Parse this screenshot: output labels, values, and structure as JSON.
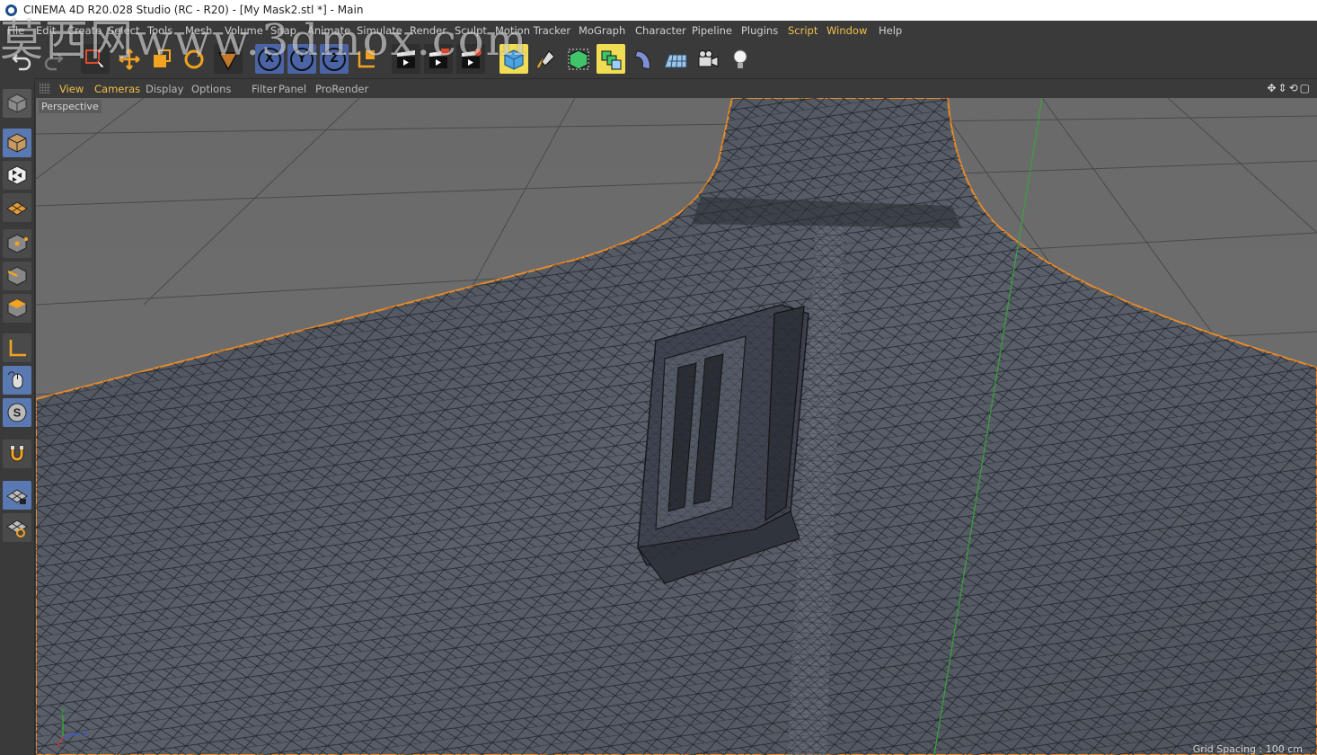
{
  "window": {
    "title": "CINEMA 4D R20.028 Studio (RC - R20) - [My Mask2.stl *] - Main"
  },
  "menu": {
    "items": [
      {
        "label": "File",
        "hl": false
      },
      {
        "label": "Edit",
        "hl": false
      },
      {
        "label": "Create",
        "hl": false
      },
      {
        "label": "Select",
        "hl": false
      },
      {
        "label": "Tools",
        "hl": false
      },
      {
        "label": "Mesh",
        "hl": false
      },
      {
        "label": "Volume",
        "hl": false
      },
      {
        "label": "Snap",
        "hl": false
      },
      {
        "label": "Animate",
        "hl": false
      },
      {
        "label": "Simulate",
        "hl": false
      },
      {
        "label": "Render",
        "hl": false
      },
      {
        "label": "Sculpt",
        "hl": false
      },
      {
        "label": "Motion Tracker",
        "hl": false
      },
      {
        "label": "MoGraph",
        "hl": false
      },
      {
        "label": "Character",
        "hl": false
      },
      {
        "label": "Pipeline",
        "hl": false
      },
      {
        "label": "Plugins",
        "hl": false
      },
      {
        "label": "Script",
        "hl": true
      },
      {
        "label": "Window",
        "hl": true
      },
      {
        "label": "Help",
        "hl": false
      }
    ]
  },
  "toolbar": {
    "axis_x": "X",
    "axis_y": "Y",
    "axis_z": "Z"
  },
  "viewport": {
    "menu": [
      {
        "label": "View",
        "hl": true
      },
      {
        "label": "Cameras",
        "hl": true
      },
      {
        "label": "Display",
        "hl": false
      },
      {
        "label": "Options",
        "hl": false
      },
      {
        "label": "Filter",
        "hl": false
      },
      {
        "label": "Panel",
        "hl": false
      },
      {
        "label": "ProRender",
        "hl": false
      }
    ],
    "nav_icons": "✥⇕⟲▢",
    "camera_label": "Perspective",
    "grid_spacing": "Grid Spacing : 100 cm",
    "axes": {
      "x": "x",
      "y": "y",
      "z": "z"
    }
  },
  "watermark": {
    "text": "莫西网www.3dmox.com"
  },
  "colors": {
    "accent": "#f2c04a",
    "selection_edge": "#e58a2c",
    "axis_y": "#3aa23a",
    "ui_bg": "#3a3a3a"
  }
}
